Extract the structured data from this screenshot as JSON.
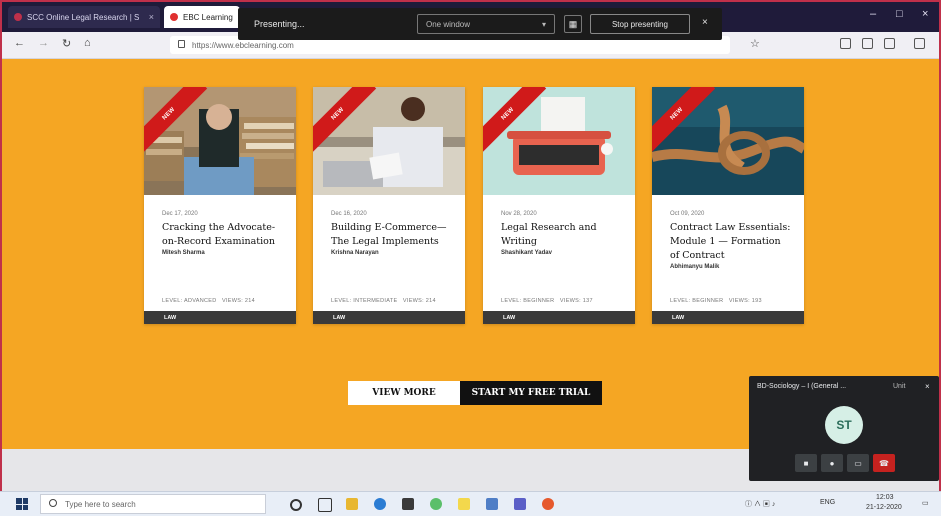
{
  "browser": {
    "tabs": [
      {
        "label": "SCC Online Legal Research | S",
        "active": false,
        "favicon_color": "#c0304a"
      },
      {
        "label": "EBC Learning",
        "active": true,
        "favicon_color": "#e03030"
      }
    ],
    "url": "https://www.ebclearning.com",
    "window_controls": [
      "–",
      "□",
      "×"
    ]
  },
  "presenting_bar": {
    "label": "Presenting...",
    "select_value": "One window",
    "stop_label": "Stop presenting"
  },
  "cards": [
    {
      "ribbon": "NEW",
      "date": "Dec 17, 2020",
      "title": "Cracking the Advocate-on-Record Examination",
      "author": "Mitesh Sharma",
      "level": "LEVEL: ADVANCED",
      "views": "VIEWS: 214",
      "footer": "LAW"
    },
    {
      "ribbon": "NEW",
      "date": "Dec 16, 2020",
      "title": "Building E-Commerce—The Legal Implements",
      "author": "Krishna Narayan",
      "level": "LEVEL: INTERMEDIATE",
      "views": "VIEWS: 214",
      "footer": "LAW"
    },
    {
      "ribbon": "NEW",
      "date": "Nov 28, 2020",
      "title": "Legal Research and Writing",
      "author": "Shashikant Yadav",
      "level": "LEVEL: BEGINNER",
      "views": "VIEWS: 137",
      "footer": "LAW"
    },
    {
      "ribbon": "NEW",
      "date": "Oct 09, 2020",
      "title": "Contract Law Essentials: Module 1 — Formation of Contract",
      "author": "Abhimanyu Malik",
      "level": "LEVEL: BEGINNER",
      "views": "VIEWS: 193",
      "footer": "LAW"
    }
  ],
  "actions": {
    "view_more": "VIEW MORE",
    "free_trial": "START MY FREE TRIAL"
  },
  "meet": {
    "title": "BD-Sociology – I (General ...",
    "unit": "Unit",
    "avatar_initials": "ST"
  },
  "taskbar": {
    "search_placeholder": "Type here to search",
    "time": "12:03",
    "date": "21-12-2020",
    "lang": "ENG"
  },
  "colors": {
    "page_bg": "#f5a623",
    "ribbon": "#d01a1a",
    "frame": "#c0304a"
  }
}
